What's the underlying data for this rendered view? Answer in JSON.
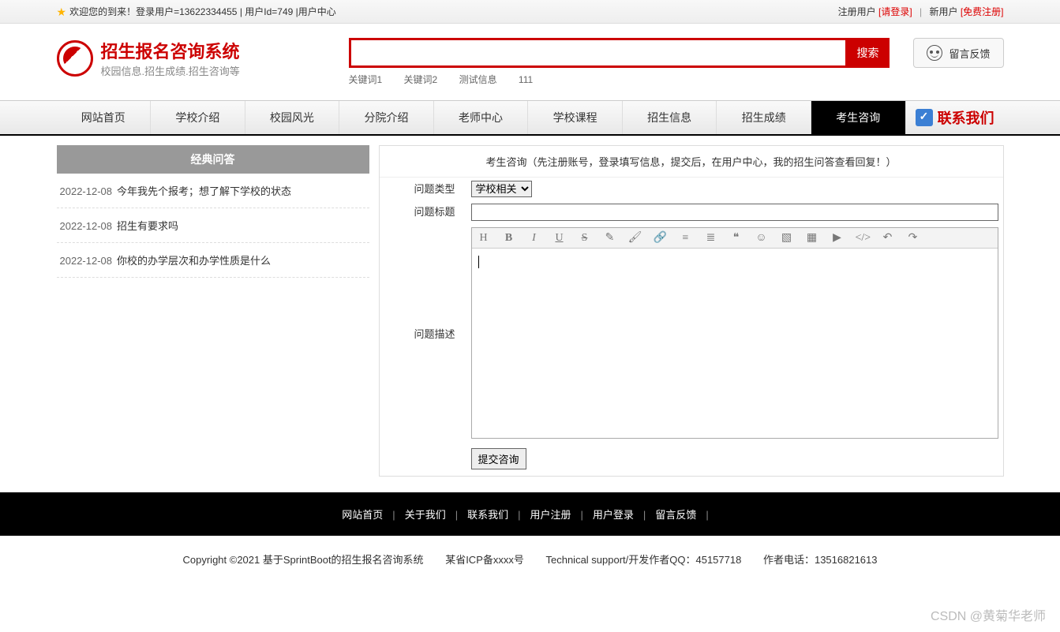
{
  "topbar": {
    "welcome": "欢迎您的到来！登录用户=13622334455 | 用户Id=749 | ",
    "userCenter": "用户中心",
    "registerUser": "注册用户",
    "loginLabel": "[请登录]",
    "newUser": "新用户",
    "freeRegister": "[免费注册]"
  },
  "logo": {
    "title": "招生报名咨询系统",
    "subtitle": "校园信息.招生成绩.招生咨询等"
  },
  "search": {
    "button": "搜索",
    "keywords": [
      "关键词1",
      "关键词2",
      "测试信息",
      "111"
    ]
  },
  "feedback": {
    "label": "留言反馈"
  },
  "nav": {
    "items": [
      "网站首页",
      "学校介绍",
      "校园风光",
      "分院介绍",
      "老师中心",
      "学校课程",
      "招生信息",
      "招生成绩",
      "考生咨询"
    ],
    "activeIndex": 8,
    "contact": "联系我们"
  },
  "sidebar": {
    "title": "经典问答",
    "items": [
      {
        "date": "2022-12-08",
        "title": "今年我先个报考；想了解下学校的状态"
      },
      {
        "date": "2022-12-08",
        "title": "招生有要求吗"
      },
      {
        "date": "2022-12-08",
        "title": "你校的办学层次和办学性质是什么"
      }
    ]
  },
  "content": {
    "headline": "考生咨询（先注册账号，登录填写信息，提交后，在用户中心，我的招生问答查看回复！）",
    "form": {
      "typeLabel": "问题类型",
      "typeValue": "学校相关",
      "titleLabel": "问题标题",
      "descLabel": "问题描述",
      "submit": "提交咨询"
    },
    "toolbarIcons": [
      "heading",
      "bold",
      "italic",
      "underline",
      "strike",
      "eraser",
      "brush",
      "link",
      "list-ol",
      "align",
      "quote",
      "emoji",
      "image",
      "table",
      "video",
      "code",
      "undo",
      "redo"
    ]
  },
  "footer": {
    "links": [
      "网站首页",
      "关于我们",
      "联系我们",
      "用户注册",
      "用户登录",
      "留言反馈"
    ],
    "copyright": "Copyright ©2021 基于SprintBoot的招生报名咨询系统",
    "icp": "某省ICP备xxxx号",
    "support": "Technical support/开发作者QQ：45157718",
    "phone": "作者电话：13516821613"
  },
  "watermark": "CSDN @黄菊华老师"
}
